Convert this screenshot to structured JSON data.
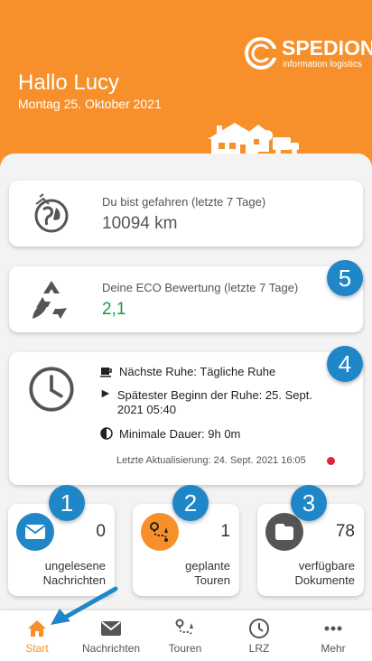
{
  "header": {
    "brand": "SPEDION",
    "brand_sub": "information logistics",
    "greeting": "Hallo Lucy",
    "date": "Montag 25. Oktober 2021"
  },
  "cards": {
    "driven": {
      "label": "Du bist gefahren (letzte 7 Tage)",
      "value": "10094 km"
    },
    "eco": {
      "label": "Deine ECO Bewertung (letzte 7 Tage)",
      "value": "2,1",
      "badge": "5"
    },
    "rest": {
      "badge": "4",
      "next_rest": "Nächste Ruhe: Tägliche Ruhe",
      "latest_start": "Spätester Beginn der Ruhe: 25. Sept. 2021 05:40",
      "min_duration": "Minimale Dauer: 9h 0m",
      "updated": "Letzte Aktualisierung: 24. Sept. 2021 16:05"
    }
  },
  "tiles": [
    {
      "badge": "1",
      "count": "0",
      "label1": "ungelesene",
      "label2": "Nachrichten"
    },
    {
      "badge": "2",
      "count": "1",
      "label1": "geplante",
      "label2": "Touren"
    },
    {
      "badge": "3",
      "count": "78",
      "label1": "verfügbare",
      "label2": "Dokumente"
    }
  ],
  "nav": [
    {
      "label": "Start",
      "icon": "home-icon",
      "active": true
    },
    {
      "label": "Nachrichten",
      "icon": "mail-icon"
    },
    {
      "label": "Touren",
      "icon": "route-icon"
    },
    {
      "label": "LRZ",
      "icon": "clock-icon"
    },
    {
      "label": "Mehr",
      "icon": "more-icon"
    }
  ],
  "colors": {
    "accent": "#f7902a",
    "badge": "#1f86c8",
    "eco_green": "#1a9d3e",
    "alert": "#e0223b"
  }
}
